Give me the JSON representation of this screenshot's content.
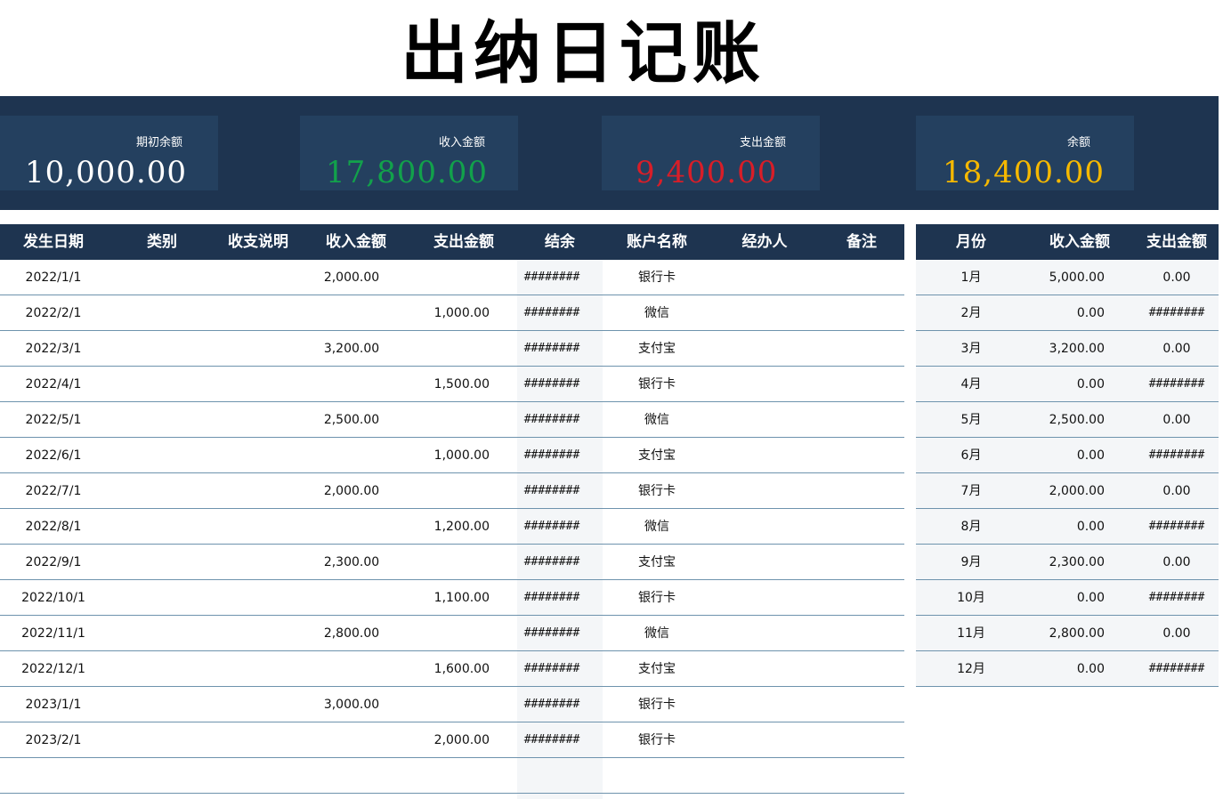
{
  "title": "出纳日记账",
  "summary": [
    {
      "label": "期初余额",
      "value": "10,000.00",
      "color": "#ffffff"
    },
    {
      "label": "收入金额",
      "value": "17,800.00",
      "color": "#12a14b"
    },
    {
      "label": "支出金额",
      "value": "9,400.00",
      "color": "#d81e28"
    },
    {
      "label": "余额",
      "value": "18,400.00",
      "color": "#f5b800"
    }
  ],
  "ledger": {
    "headers": [
      "发生日期",
      "类别",
      "收支说明",
      "收入金额",
      "支出金额",
      "结余",
      "账户名称",
      "经办人",
      "备注"
    ],
    "rows": [
      {
        "date": "2022/1/1",
        "category": "",
        "desc": "",
        "income": "2,000.00",
        "expense": "",
        "balance": "########",
        "account": "银行卡",
        "handler": "",
        "note": ""
      },
      {
        "date": "2022/2/1",
        "category": "",
        "desc": "",
        "income": "",
        "expense": "1,000.00",
        "balance": "########",
        "account": "微信",
        "handler": "",
        "note": ""
      },
      {
        "date": "2022/3/1",
        "category": "",
        "desc": "",
        "income": "3,200.00",
        "expense": "",
        "balance": "########",
        "account": "支付宝",
        "handler": "",
        "note": ""
      },
      {
        "date": "2022/4/1",
        "category": "",
        "desc": "",
        "income": "",
        "expense": "1,500.00",
        "balance": "########",
        "account": "银行卡",
        "handler": "",
        "note": ""
      },
      {
        "date": "2022/5/1",
        "category": "",
        "desc": "",
        "income": "2,500.00",
        "expense": "",
        "balance": "########",
        "account": "微信",
        "handler": "",
        "note": ""
      },
      {
        "date": "2022/6/1",
        "category": "",
        "desc": "",
        "income": "",
        "expense": "1,000.00",
        "balance": "########",
        "account": "支付宝",
        "handler": "",
        "note": ""
      },
      {
        "date": "2022/7/1",
        "category": "",
        "desc": "",
        "income": "2,000.00",
        "expense": "",
        "balance": "########",
        "account": "银行卡",
        "handler": "",
        "note": ""
      },
      {
        "date": "2022/8/1",
        "category": "",
        "desc": "",
        "income": "",
        "expense": "1,200.00",
        "balance": "########",
        "account": "微信",
        "handler": "",
        "note": ""
      },
      {
        "date": "2022/9/1",
        "category": "",
        "desc": "",
        "income": "2,300.00",
        "expense": "",
        "balance": "########",
        "account": "支付宝",
        "handler": "",
        "note": ""
      },
      {
        "date": "2022/10/1",
        "category": "",
        "desc": "",
        "income": "",
        "expense": "1,100.00",
        "balance": "########",
        "account": "银行卡",
        "handler": "",
        "note": ""
      },
      {
        "date": "2022/11/1",
        "category": "",
        "desc": "",
        "income": "2,800.00",
        "expense": "",
        "balance": "########",
        "account": "微信",
        "handler": "",
        "note": ""
      },
      {
        "date": "2022/12/1",
        "category": "",
        "desc": "",
        "income": "",
        "expense": "1,600.00",
        "balance": "########",
        "account": "支付宝",
        "handler": "",
        "note": ""
      },
      {
        "date": "2023/1/1",
        "category": "",
        "desc": "",
        "income": "3,000.00",
        "expense": "",
        "balance": "########",
        "account": "银行卡",
        "handler": "",
        "note": ""
      },
      {
        "date": "2023/2/1",
        "category": "",
        "desc": "",
        "income": "",
        "expense": "2,000.00",
        "balance": "########",
        "account": "银行卡",
        "handler": "",
        "note": ""
      },
      {
        "date": "",
        "category": "",
        "desc": "",
        "income": "",
        "expense": "",
        "balance": "",
        "account": "",
        "handler": "",
        "note": ""
      }
    ]
  },
  "monthly": {
    "headers": [
      "月份",
      "收入金额",
      "支出金额"
    ],
    "rows": [
      {
        "month": "1月",
        "income": "5,000.00",
        "expense": "0.00"
      },
      {
        "month": "2月",
        "income": "0.00",
        "expense": "########"
      },
      {
        "month": "3月",
        "income": "3,200.00",
        "expense": "0.00"
      },
      {
        "month": "4月",
        "income": "0.00",
        "expense": "########"
      },
      {
        "month": "5月",
        "income": "2,500.00",
        "expense": "0.00"
      },
      {
        "month": "6月",
        "income": "0.00",
        "expense": "########"
      },
      {
        "month": "7月",
        "income": "2,000.00",
        "expense": "0.00"
      },
      {
        "month": "8月",
        "income": "0.00",
        "expense": "########"
      },
      {
        "month": "9月",
        "income": "2,300.00",
        "expense": "0.00"
      },
      {
        "month": "10月",
        "income": "0.00",
        "expense": "########"
      },
      {
        "month": "11月",
        "income": "2,800.00",
        "expense": "0.00"
      },
      {
        "month": "12月",
        "income": "0.00",
        "expense": "########"
      }
    ]
  }
}
